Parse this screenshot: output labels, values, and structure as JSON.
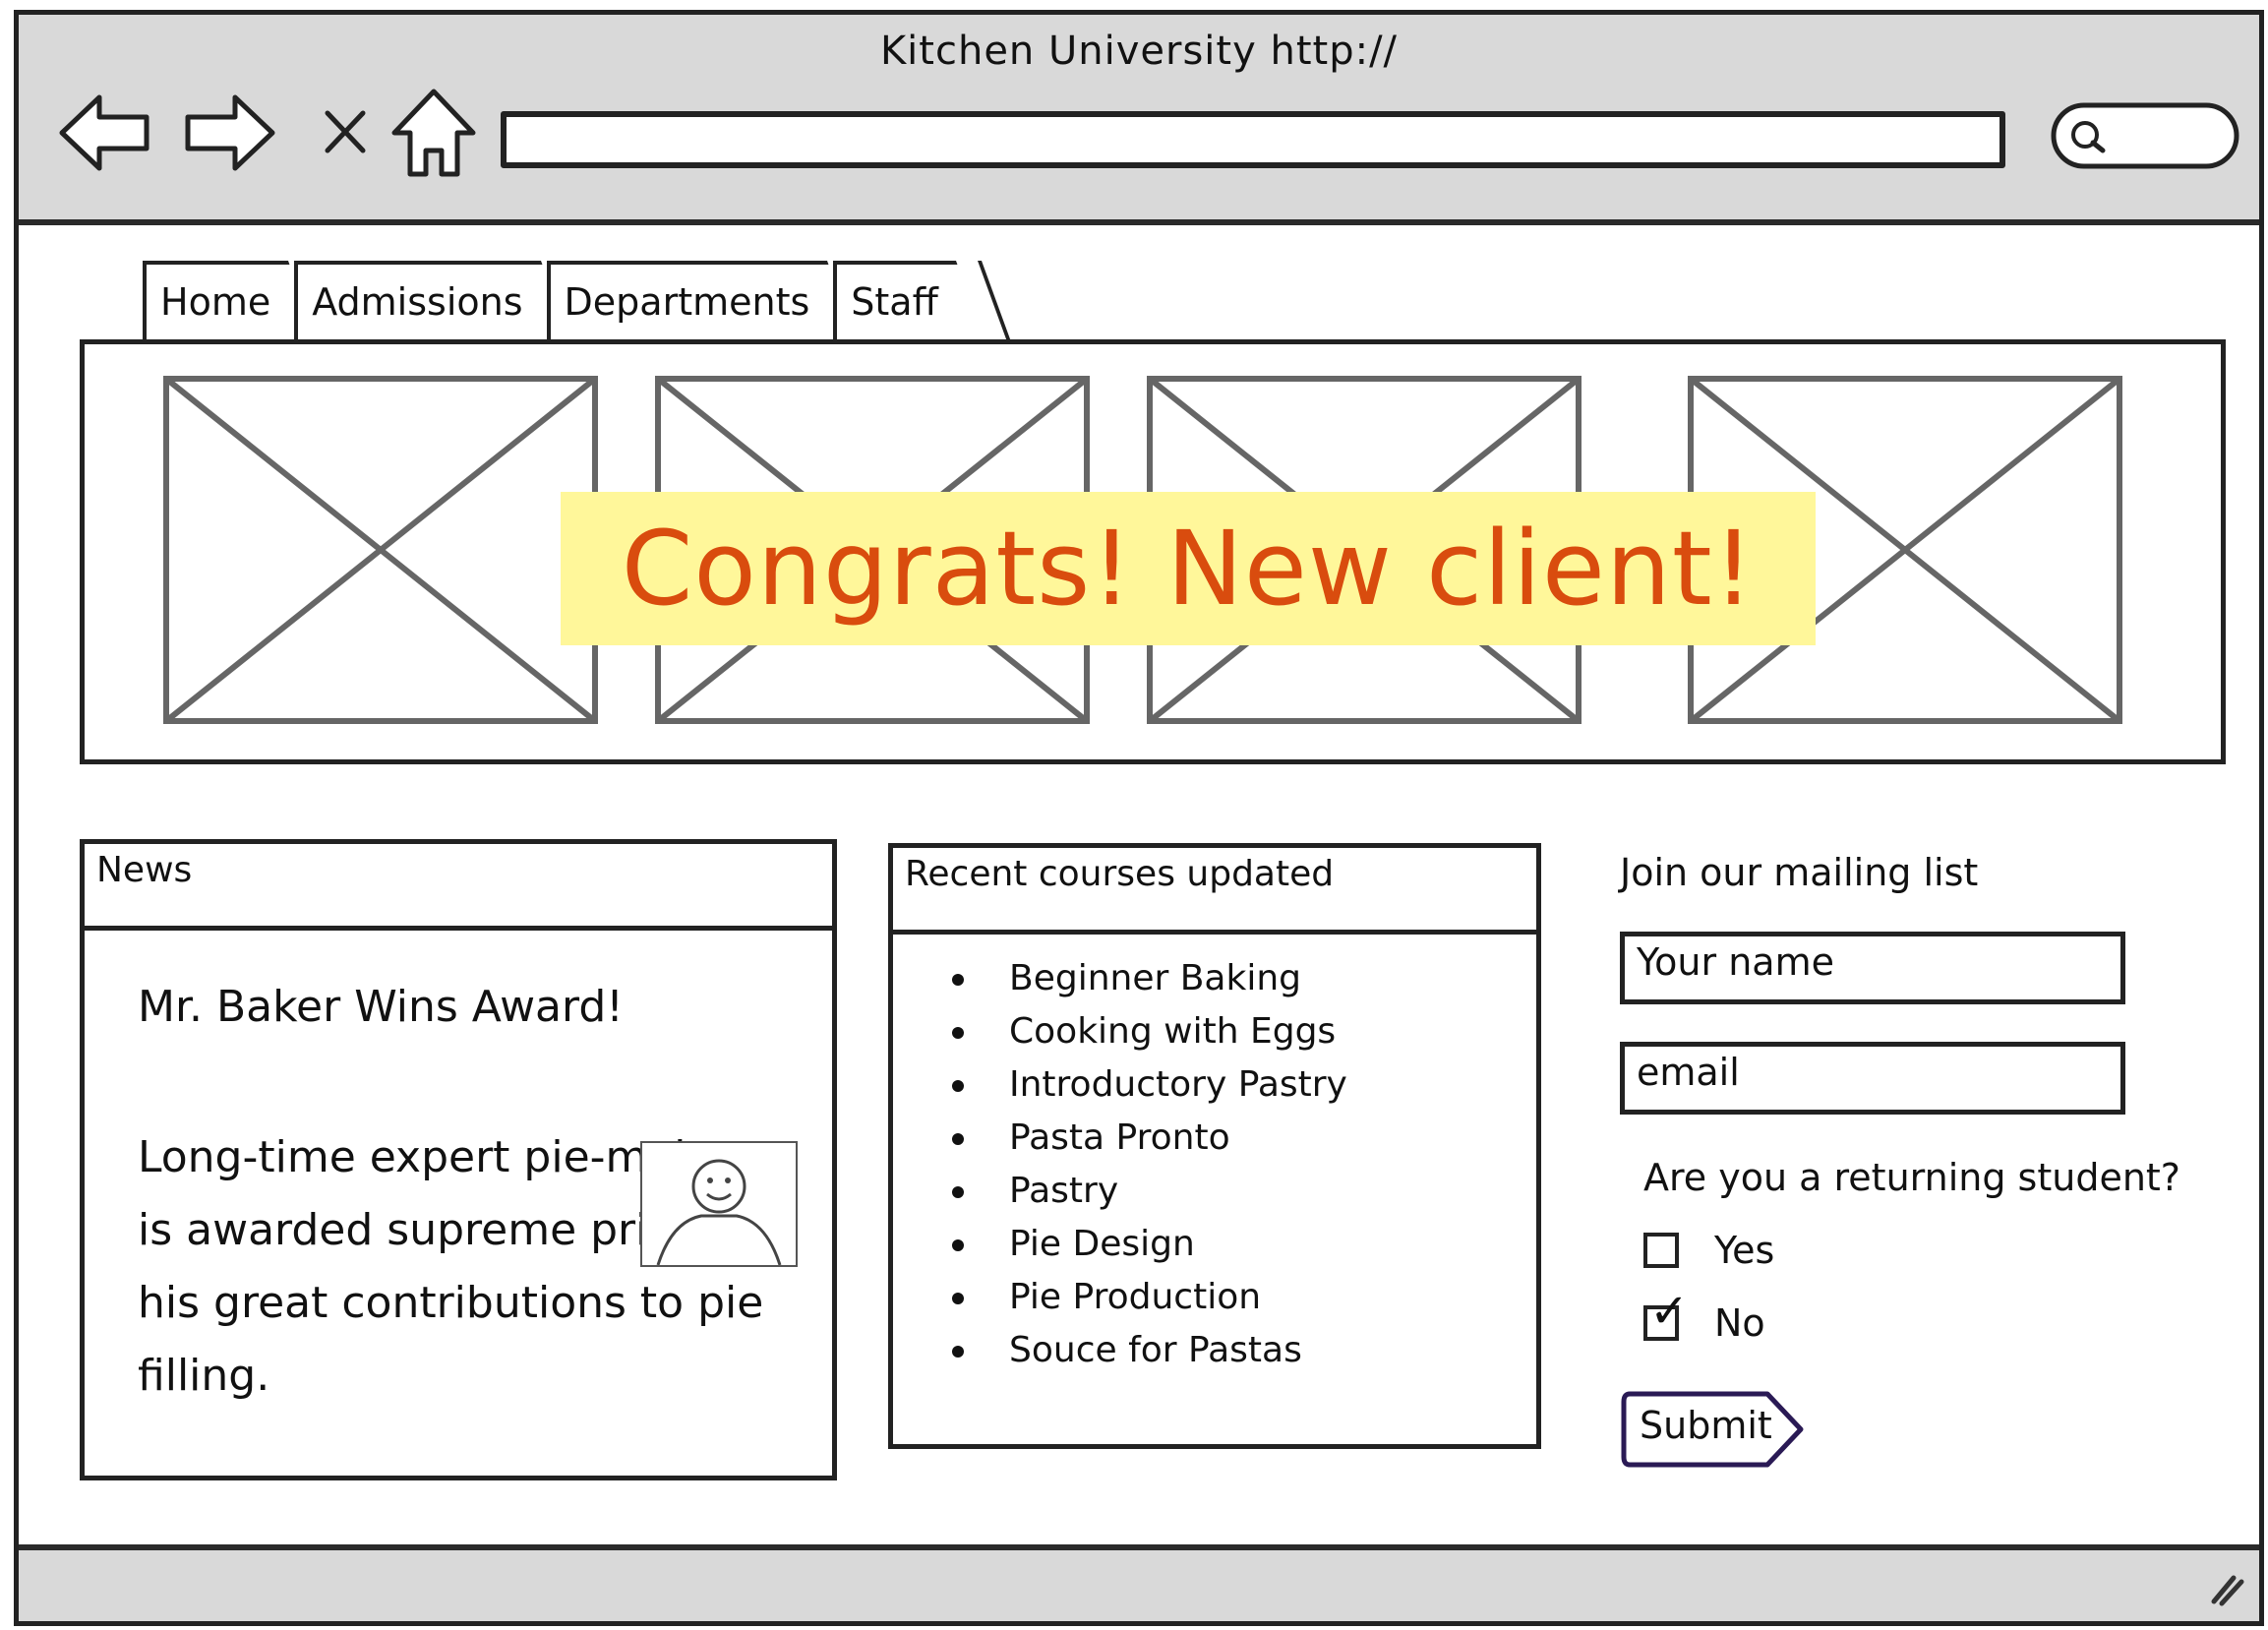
{
  "window": {
    "title": "Kitchen University http://"
  },
  "browser": {
    "icons": [
      "back-arrow-icon",
      "forward-arrow-icon",
      "close-icon",
      "home-icon",
      "search-icon"
    ],
    "address_value": ""
  },
  "tabs": [
    {
      "label": "Home"
    },
    {
      "label": "Admissions"
    },
    {
      "label": "Departments"
    },
    {
      "label": "Staff"
    }
  ],
  "banner": {
    "text": "Congrats! New client!",
    "background": "#fff79a",
    "color": "#d94c0e"
  },
  "news": {
    "header": "News",
    "headline": "Mr. Baker Wins Award!",
    "body": "Long-time expert pie-maker is awarded supreme prize for his great contributions to pie filling."
  },
  "courses": {
    "header": "Recent courses updated",
    "items": [
      "Beginner Baking",
      "Cooking with Eggs",
      "Introductory Pastry",
      "Pasta Pronto",
      "Pastry",
      "Pie Design",
      "Pie Production",
      "Souce for Pastas"
    ]
  },
  "mailing": {
    "title": "Join our mailing list",
    "name_placeholder": "Your name",
    "email_placeholder": "email",
    "question": "Are you a returning student?",
    "options": [
      {
        "label": "Yes",
        "checked": false
      },
      {
        "label": "No",
        "checked": true
      }
    ],
    "submit_label": "Submit"
  }
}
